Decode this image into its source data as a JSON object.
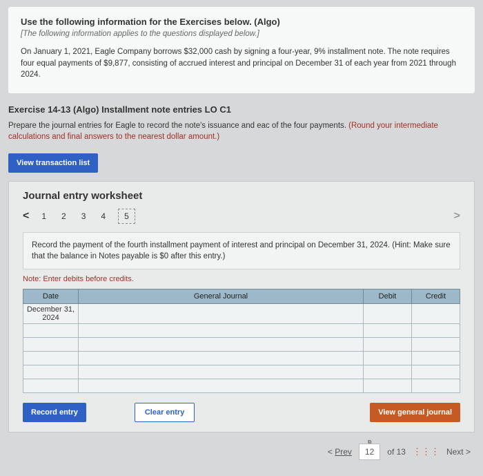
{
  "info": {
    "title": "Use the following information for the Exercises below. (Algo)",
    "subtitle": "[The following information applies to the questions displayed below.]",
    "body": "On January 1, 2021, Eagle Company borrows $32,000 cash by signing a four-year, 9% installment note. The note requires four equal payments of $9,877, consisting of accrued interest and principal on December 31 of each year from 2021 through 2024."
  },
  "exercise_head": "Exercise 14-13 (Algo) Installment note entries LO C1",
  "question": {
    "lead": "Prepare the journal entries for Eagle to record the note's issuance and eac  of the four payments. ",
    "red": "(Round your intermediate calculations and final answers to the nearest dollar amount.)"
  },
  "btn_view_trans": "View transaction list",
  "worksheet": {
    "title": "Journal entry worksheet",
    "tabs": [
      "1",
      "2",
      "3",
      "4",
      "5"
    ],
    "active_tab": "5",
    "instruction": "Record the payment of the fourth installment payment of interest and principal on December 31, 2024. (Hint: Make sure that the balance in Notes payable is $0 after this entry.)",
    "note": "Note: Enter debits before credits.",
    "headers": {
      "date": "Date",
      "gj": "General Journal",
      "debit": "Debit",
      "credit": "Credit"
    },
    "date_value": "December 31, 2024",
    "btn_record": "Record entry",
    "btn_clear": "Clear entry",
    "btn_vgj": "View general journal"
  },
  "footer": {
    "prev": "Prev",
    "page_current": "12",
    "page_total": "of 13",
    "next": "Next"
  }
}
